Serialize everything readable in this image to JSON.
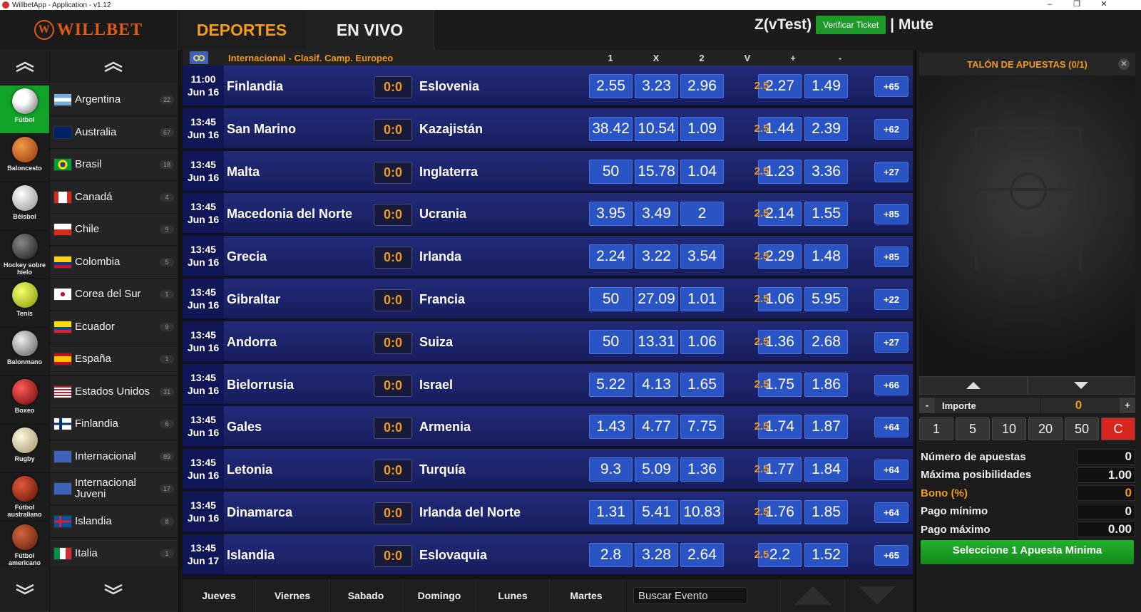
{
  "window": {
    "title": "WillbetApp - Application - v1.12"
  },
  "header": {
    "logo_text": "WILLBET",
    "logo_letter": "W",
    "tabs": [
      {
        "label": "DEPORTES"
      },
      {
        "label": "EN VIVO"
      }
    ],
    "user": "Z(vTest)",
    "verify_label": "Verificar Ticket",
    "mute_label": "| Mute"
  },
  "sports": [
    {
      "label": "Fútbol",
      "icon": "soccer-ball-icon",
      "active": true
    },
    {
      "label": "Baloncesto",
      "icon": "basketball-icon"
    },
    {
      "label": "Béisbol",
      "icon": "baseball-icon"
    },
    {
      "label": "Hockey sobre hielo",
      "icon": "hockey-icon"
    },
    {
      "label": "Tenis",
      "icon": "tennis-ball-icon"
    },
    {
      "label": "Balonmano",
      "icon": "handball-icon"
    },
    {
      "label": "Boxeo",
      "icon": "boxing-glove-icon"
    },
    {
      "label": "Rugby",
      "icon": "rugby-ball-icon"
    },
    {
      "label": "Fútbol australiano",
      "icon": "australian-football-icon"
    },
    {
      "label": "Fútbol americano",
      "icon": "american-football-icon"
    }
  ],
  "countries": [
    {
      "name": "Argentina",
      "count": "22",
      "flag": "argentina"
    },
    {
      "name": "Australia",
      "count": "67",
      "flag": "australia"
    },
    {
      "name": "Brasil",
      "count": "18",
      "flag": "brasil"
    },
    {
      "name": "Canadá",
      "count": "4",
      "flag": "canada"
    },
    {
      "name": "Chile",
      "count": "9",
      "flag": "chile"
    },
    {
      "name": "Colombia",
      "count": "5",
      "flag": "colombia"
    },
    {
      "name": "Corea del Sur",
      "count": "1",
      "flag": "korea"
    },
    {
      "name": "Ecuador",
      "count": "9",
      "flag": "ecuador"
    },
    {
      "name": "España",
      "count": "1",
      "flag": "spain"
    },
    {
      "name": "Estados Unidos",
      "count": "31",
      "flag": "usa"
    },
    {
      "name": "Finlandia",
      "count": "6",
      "flag": "finland"
    },
    {
      "name": "Internacional",
      "count": "89",
      "flag": "intl"
    },
    {
      "name": "Internacional Juveni",
      "count": "17",
      "flag": "intl"
    },
    {
      "name": "Islandia",
      "count": "8",
      "flag": "iceland"
    },
    {
      "name": "Italia",
      "count": "1",
      "flag": "italy"
    }
  ],
  "league": {
    "name": "Internacional - Clasif. Camp. Europeo",
    "columns": [
      "1",
      "X",
      "2",
      "V",
      "+",
      "-"
    ]
  },
  "matches": [
    {
      "time": "11:00",
      "date": "Jun 16",
      "home": "Finlandia",
      "score": "0:0",
      "away": "Eslovenia",
      "o1": "2.55",
      "ox": "3.23",
      "o2": "2.96",
      "line": "2.5",
      "over": "2.27",
      "under": "1.49",
      "more": "+65"
    },
    {
      "time": "13:45",
      "date": "Jun 16",
      "home": "San Marino",
      "score": "0:0",
      "away": "Kazajistán",
      "o1": "38.42",
      "ox": "10.54",
      "o2": "1.09",
      "line": "2.5",
      "over": "1.44",
      "under": "2.39",
      "more": "+62"
    },
    {
      "time": "13:45",
      "date": "Jun 16",
      "home": "Malta",
      "score": "0:0",
      "away": "Inglaterra",
      "o1": "50",
      "ox": "15.78",
      "o2": "1.04",
      "line": "2.5",
      "over": "1.23",
      "under": "3.36",
      "more": "+27"
    },
    {
      "time": "13:45",
      "date": "Jun 16",
      "home": "Macedonia del Norte",
      "score": "0:0",
      "away": "Ucrania",
      "o1": "3.95",
      "ox": "3.49",
      "o2": "2",
      "line": "2.5",
      "over": "2.14",
      "under": "1.55",
      "more": "+85"
    },
    {
      "time": "13:45",
      "date": "Jun 16",
      "home": "Grecia",
      "score": "0:0",
      "away": "Irlanda",
      "o1": "2.24",
      "ox": "3.22",
      "o2": "3.54",
      "line": "2.5",
      "over": "2.29",
      "under": "1.48",
      "more": "+85"
    },
    {
      "time": "13:45",
      "date": "Jun 16",
      "home": "Gibraltar",
      "score": "0:0",
      "away": "Francia",
      "o1": "50",
      "ox": "27.09",
      "o2": "1.01",
      "line": "2.5",
      "over": "1.06",
      "under": "5.95",
      "more": "+22"
    },
    {
      "time": "13:45",
      "date": "Jun 16",
      "home": "Andorra",
      "score": "0:0",
      "away": "Suiza",
      "o1": "50",
      "ox": "13.31",
      "o2": "1.06",
      "line": "2.5",
      "over": "1.36",
      "under": "2.68",
      "more": "+27"
    },
    {
      "time": "13:45",
      "date": "Jun 16",
      "home": "Bielorrusia",
      "score": "0:0",
      "away": "Israel",
      "o1": "5.22",
      "ox": "4.13",
      "o2": "1.65",
      "line": "2.5",
      "over": "1.75",
      "under": "1.86",
      "more": "+66"
    },
    {
      "time": "13:45",
      "date": "Jun 16",
      "home": "Gales",
      "score": "0:0",
      "away": "Armenia",
      "o1": "1.43",
      "ox": "4.77",
      "o2": "7.75",
      "line": "2.5",
      "over": "1.74",
      "under": "1.87",
      "more": "+64"
    },
    {
      "time": "13:45",
      "date": "Jun 16",
      "home": "Letonia",
      "score": "0:0",
      "away": "Turquía",
      "o1": "9.3",
      "ox": "5.09",
      "o2": "1.36",
      "line": "2.5",
      "over": "1.77",
      "under": "1.84",
      "more": "+64"
    },
    {
      "time": "13:45",
      "date": "Jun 16",
      "home": "Dinamarca",
      "score": "0:0",
      "away": "Irlanda del Norte",
      "o1": "1.31",
      "ox": "5.41",
      "o2": "10.83",
      "line": "2.5",
      "over": "1.76",
      "under": "1.85",
      "more": "+64"
    },
    {
      "time": "13:45",
      "date": "Jun 17",
      "home": "Islandia",
      "score": "0:0",
      "away": "Eslovaquia",
      "o1": "2.8",
      "ox": "3.28",
      "o2": "2.64",
      "line": "2.5",
      "over": "2.2",
      "under": "1.52",
      "more": "+65"
    }
  ],
  "days": [
    "Jueves",
    "Viernes",
    "Sabado",
    "Domingo",
    "Lunes",
    "Martes"
  ],
  "search": {
    "value": "Buscar Evento"
  },
  "betslip": {
    "title": "TALÓN DE APUESTAS (0/1)",
    "importe_label": "Importe",
    "importe_value": "0",
    "minus": "-",
    "plus": "+",
    "chips": [
      "1",
      "5",
      "10",
      "20",
      "50",
      "C"
    ],
    "stats": [
      {
        "label": "Número de apuestas",
        "value": "0"
      },
      {
        "label": "Máxima posibilidades",
        "value": "1.00"
      },
      {
        "label": "Bono (%)",
        "value": "0"
      },
      {
        "label": "Pago mínimo",
        "value": "0"
      },
      {
        "label": "Pago máximo",
        "value": "0.00"
      }
    ],
    "submit_label": "Seleccione 1 Apuesta Minima"
  },
  "colors": {
    "accent": "#f29a1e",
    "odds": "#2a54c4",
    "row": "#1d2470",
    "active_sport": "#11a22a",
    "logo": "#e05a14",
    "clear": "#d8261f"
  }
}
